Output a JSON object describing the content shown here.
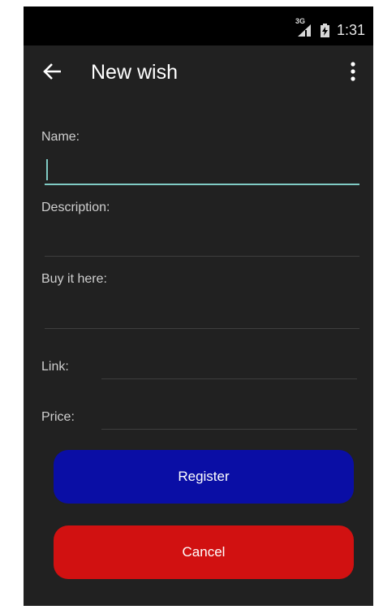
{
  "status_bar": {
    "network": "3G",
    "time": "1:31"
  },
  "action_bar": {
    "title": "New wish"
  },
  "form": {
    "name_label": "Name:",
    "name_value": "",
    "description_label": "Description:",
    "description_value": "",
    "buy_label": "Buy it here:",
    "buy_value": "",
    "link_label": "Link:",
    "link_value": "",
    "price_label": "Price:",
    "price_value": ""
  },
  "buttons": {
    "register_label": "Register",
    "cancel_label": "Cancel"
  },
  "colors": {
    "accent": "#80cbc4",
    "register_button": "#0a0ea5",
    "cancel_button": "#d11111",
    "background": "#212121"
  },
  "icons": {
    "back": "arrow-left-icon",
    "menu": "overflow-menu-icon",
    "signal": "signal-icon",
    "battery": "battery-icon"
  }
}
